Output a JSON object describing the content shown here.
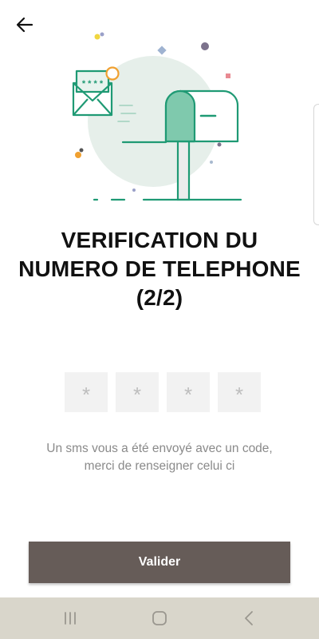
{
  "header": {
    "back_icon": "arrow-left-icon"
  },
  "illustration": {
    "icon": "mailbox-envelope-illustration",
    "accent_color": "#1f9a74",
    "circle_color": "#e6efea"
  },
  "title": {
    "line1": "VERIFICATION DU",
    "line2": "NUMERO DE TELEPHONE",
    "line3": "(2/2)"
  },
  "code_input": {
    "digits": [
      "*",
      "*",
      "*",
      "*"
    ]
  },
  "instructions": {
    "line1": "Un sms vous a été envoyé avec un code,",
    "line2": "merci de renseigner celui ci"
  },
  "submit": {
    "label": "Valider",
    "color": "#665c58"
  },
  "nav_bar": {
    "recent_icon": "recent-apps-icon",
    "home_icon": "home-icon",
    "back_icon": "back-chevron-icon",
    "color": "#d9d6cb"
  }
}
